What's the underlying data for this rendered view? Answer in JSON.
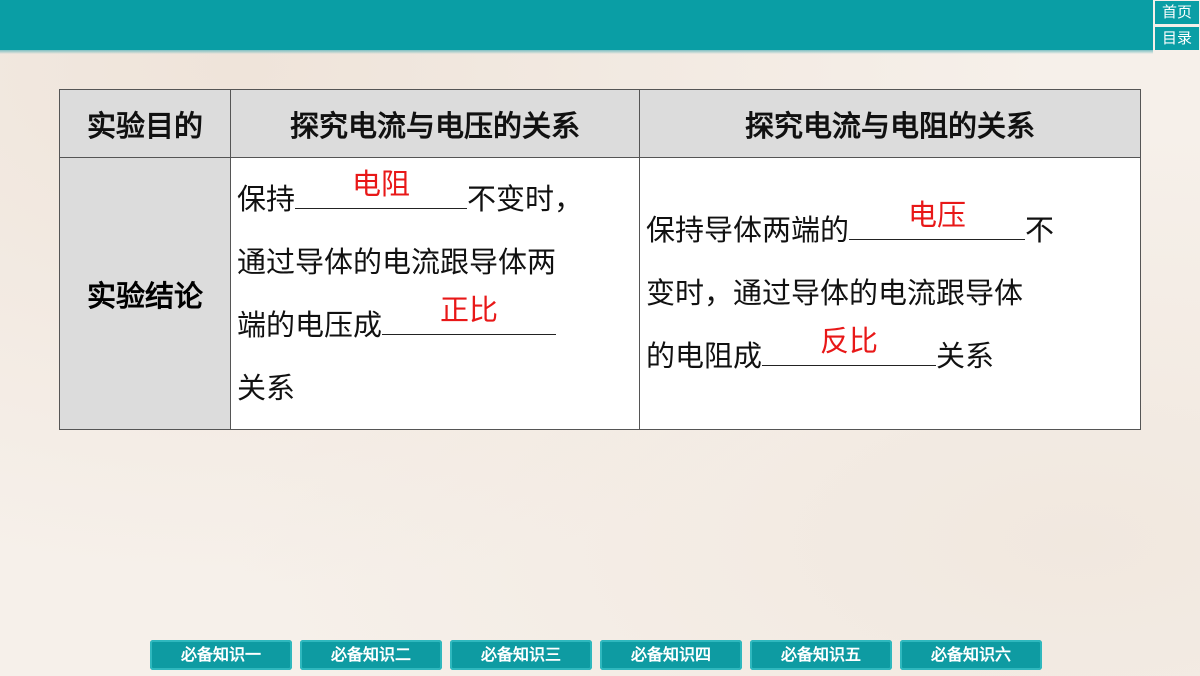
{
  "nav": {
    "home": "首页",
    "toc": "目录"
  },
  "table": {
    "header": [
      "实验目的",
      "探究电流与电压的关系",
      "探究电流与电阻的关系"
    ],
    "row_label": "实验结论",
    "voltage": {
      "t1": "保持",
      "a1": "电阻",
      "t2": "不变时，",
      "t3": "通过导体的电流跟导体两",
      "t4": "端的电压成",
      "a2": "正比",
      "t5": "关系"
    },
    "resistance": {
      "t1": "保持导体两端的",
      "a1": "电压",
      "t2": "不",
      "t3": "变时，通过导体的电流跟导体",
      "t4": "的电阻成",
      "a2": "反比",
      "t5": "关系"
    }
  },
  "tabs": [
    "必备知识一",
    "必备知识二",
    "必备知识三",
    "必备知识四",
    "必备知识五",
    "必备知识六"
  ],
  "colors": {
    "accent": "#0a9ea5",
    "answer": "#e81818"
  }
}
